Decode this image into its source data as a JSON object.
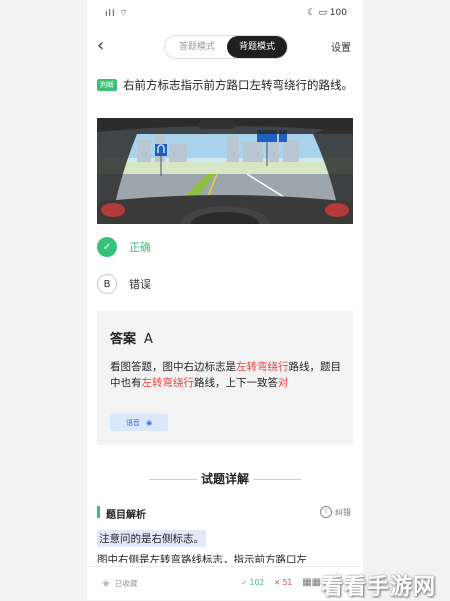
{
  "status_bar": {
    "signal": "ıll ⌔",
    "right": "☾ ▭ 100"
  },
  "header": {
    "back_label": "‹",
    "tabs": [
      {
        "label": "答题模式",
        "active": false
      },
      {
        "label": "背题模式",
        "active": true
      }
    ],
    "settings_label": "设置"
  },
  "question": {
    "type_badge": "判断",
    "text": "右前方标志指示前方路口左转弯绕行的路线。"
  },
  "options": [
    {
      "key": "✓",
      "label": "正确",
      "selected": true
    },
    {
      "key": "B",
      "label": "错误",
      "selected": false
    }
  ],
  "answer": {
    "title": "答案",
    "letter": "A",
    "exp_1": "看图答题，图中右边标志是",
    "exp_red_1": "左转弯绕行",
    "exp_2": "路线，题目中也有",
    "exp_red_2": "左转弯绕行",
    "exp_3": "路线，上下一致答",
    "exp_red_3": "对",
    "voice_label": "语音"
  },
  "section": {
    "title": "试题详解"
  },
  "analysis": {
    "heading": "题目解析",
    "correction_label": "纠错",
    "line_1": "注意问的是右侧标志。",
    "line_2": "图中右侧是左转弯路线标志，指示前方路口左"
  },
  "bottom_bar": {
    "favorite_label": "已收藏",
    "correct_count": "✓ 102",
    "wrong_count": "✕ 51",
    "grid_label": "▦▦"
  },
  "watermark": "看看手游网",
  "colors": {
    "accent_green": "#36c27a",
    "highlight_red": "#e64545",
    "voice_blue": "#3b6fd8"
  }
}
